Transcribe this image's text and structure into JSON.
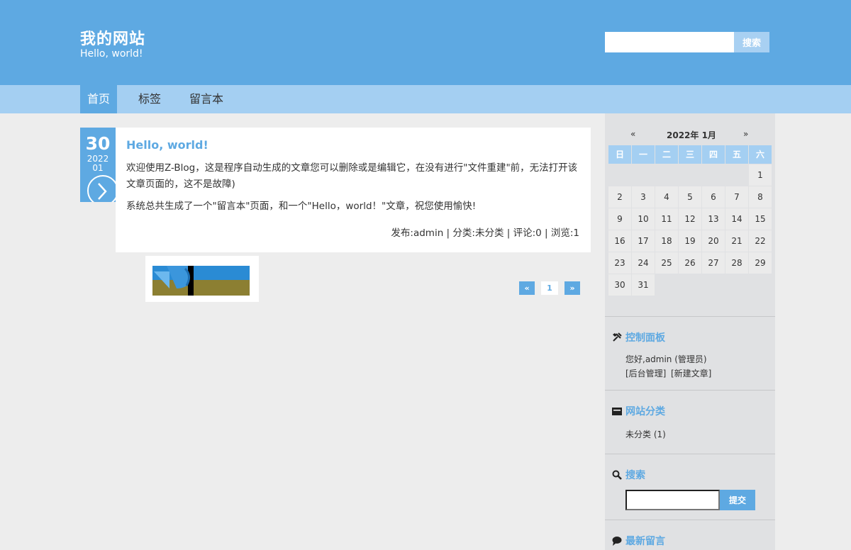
{
  "site": {
    "title": "我的网站",
    "subtitle": "Hello, world!"
  },
  "top_search": {
    "placeholder": "",
    "button": "搜索"
  },
  "nav": [
    {
      "label": "首页",
      "active": true
    },
    {
      "label": "标签",
      "active": false
    },
    {
      "label": "留言本",
      "active": false
    }
  ],
  "post": {
    "day": "30",
    "year": "2022",
    "month": "01",
    "title": "Hello, world!",
    "p1": "欢迎使用Z-Blog，这是程序自动生成的文章您可以删除或是编辑它，在没有进行\"文件重建\"前，无法打开该文章页面的，这不是故障)",
    "p2": "系统总共生成了一个\"留言本\"页面，和一个\"Hello，world！\"文章，祝您使用愉快!",
    "meta": "发布:admin | 分类:未分类 | 评论:0 | 浏览:1"
  },
  "pager": {
    "prev": "«",
    "current": "1",
    "next": "»"
  },
  "calendar": {
    "prev": "«",
    "title": "2022年 1月",
    "next": "»",
    "weekdays": [
      "日",
      "一",
      "二",
      "三",
      "四",
      "五",
      "六"
    ],
    "weeks": [
      [
        "",
        "",
        "",
        "",
        "",
        "",
        "1"
      ],
      [
        "2",
        "3",
        "4",
        "5",
        "6",
        "7",
        "8"
      ],
      [
        "9",
        "10",
        "11",
        "12",
        "13",
        "14",
        "15"
      ],
      [
        "16",
        "17",
        "18",
        "19",
        "20",
        "21",
        "22"
      ],
      [
        "23",
        "24",
        "25",
        "26",
        "27",
        "28",
        "29"
      ],
      [
        "30",
        "31",
        "",
        "",
        "",
        "",
        ""
      ]
    ]
  },
  "control_panel": {
    "title": "控制面板",
    "greeting": "您好,admin (管理员)",
    "admin_link": "[后台管理]",
    "new_post_link": "[新建文章]"
  },
  "categories": {
    "title": "网站分类",
    "item": "未分类 (1)"
  },
  "side_search": {
    "title": "搜索",
    "placeholder": "",
    "button": "提交"
  },
  "latest_comments": {
    "title": "最新留言"
  },
  "colors": {
    "primary": "#5ea9e2",
    "nav_bg": "#a4cff2",
    "page_bg": "#ededed",
    "sidebar_bg": "#e0e1e3"
  }
}
